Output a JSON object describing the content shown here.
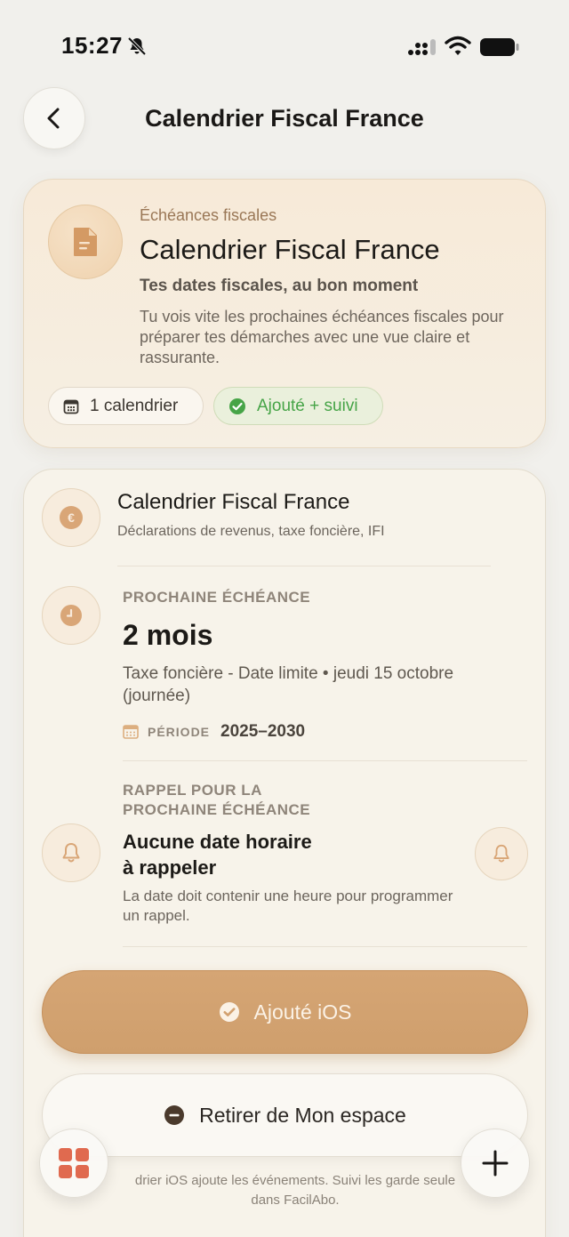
{
  "status_bar": {
    "time": "15:27"
  },
  "nav": {
    "title": "Calendrier Fiscal France"
  },
  "hero": {
    "eyebrow": "Échéances fiscales",
    "title": "Calendrier Fiscal France",
    "subtitle": "Tes dates fiscales, au bon moment",
    "description": "Tu vois vite les prochaines échéances fiscales pour préparer tes démarches avec une vue claire et rassurante.",
    "chips": {
      "calendar_count": "1 calendrier",
      "status": "Ajouté + suivi"
    }
  },
  "calendar": {
    "name": "Calendrier Fiscal France",
    "summary": "Déclarations de revenus, taxe foncière, IFI",
    "currency_symbol": "€"
  },
  "next_deadline": {
    "label": "PROCHAINE ÉCHÉANCE",
    "value": "2 mois",
    "description": "Taxe foncière - Date limite • jeudi 15 octobre (journée)",
    "period_label": "PÉRIODE",
    "period_value": "2025–2030"
  },
  "reminder": {
    "label_line1": "RAPPEL POUR LA",
    "label_line2": "PROCHAINE ÉCHÉANCE",
    "title_line1": "Aucune date horaire",
    "title_line2": "à rappeler",
    "description": "La date doit contenir une heure pour programmer un rappel."
  },
  "actions": {
    "primary_label": "Ajouté iOS",
    "secondary_label": "Retirer de Mon espace",
    "footer_note_line1": "drier iOS ajoute les événements. Suivi les garde seule",
    "footer_note_line2": "dans FacilAbo."
  },
  "colors": {
    "accent": "#d2a170",
    "success": "#46a447",
    "background": "#f1f0ec",
    "grid_icon": "#e06a4f"
  },
  "icons": {
    "back": "chevron-left-icon",
    "document": "document-icon",
    "calendar": "calendar-icon",
    "check": "check-circle-icon",
    "clock": "clock-icon",
    "bell": "bell-icon",
    "minus": "minus-circle-icon",
    "grid": "grid-icon",
    "plus": "plus-icon"
  }
}
